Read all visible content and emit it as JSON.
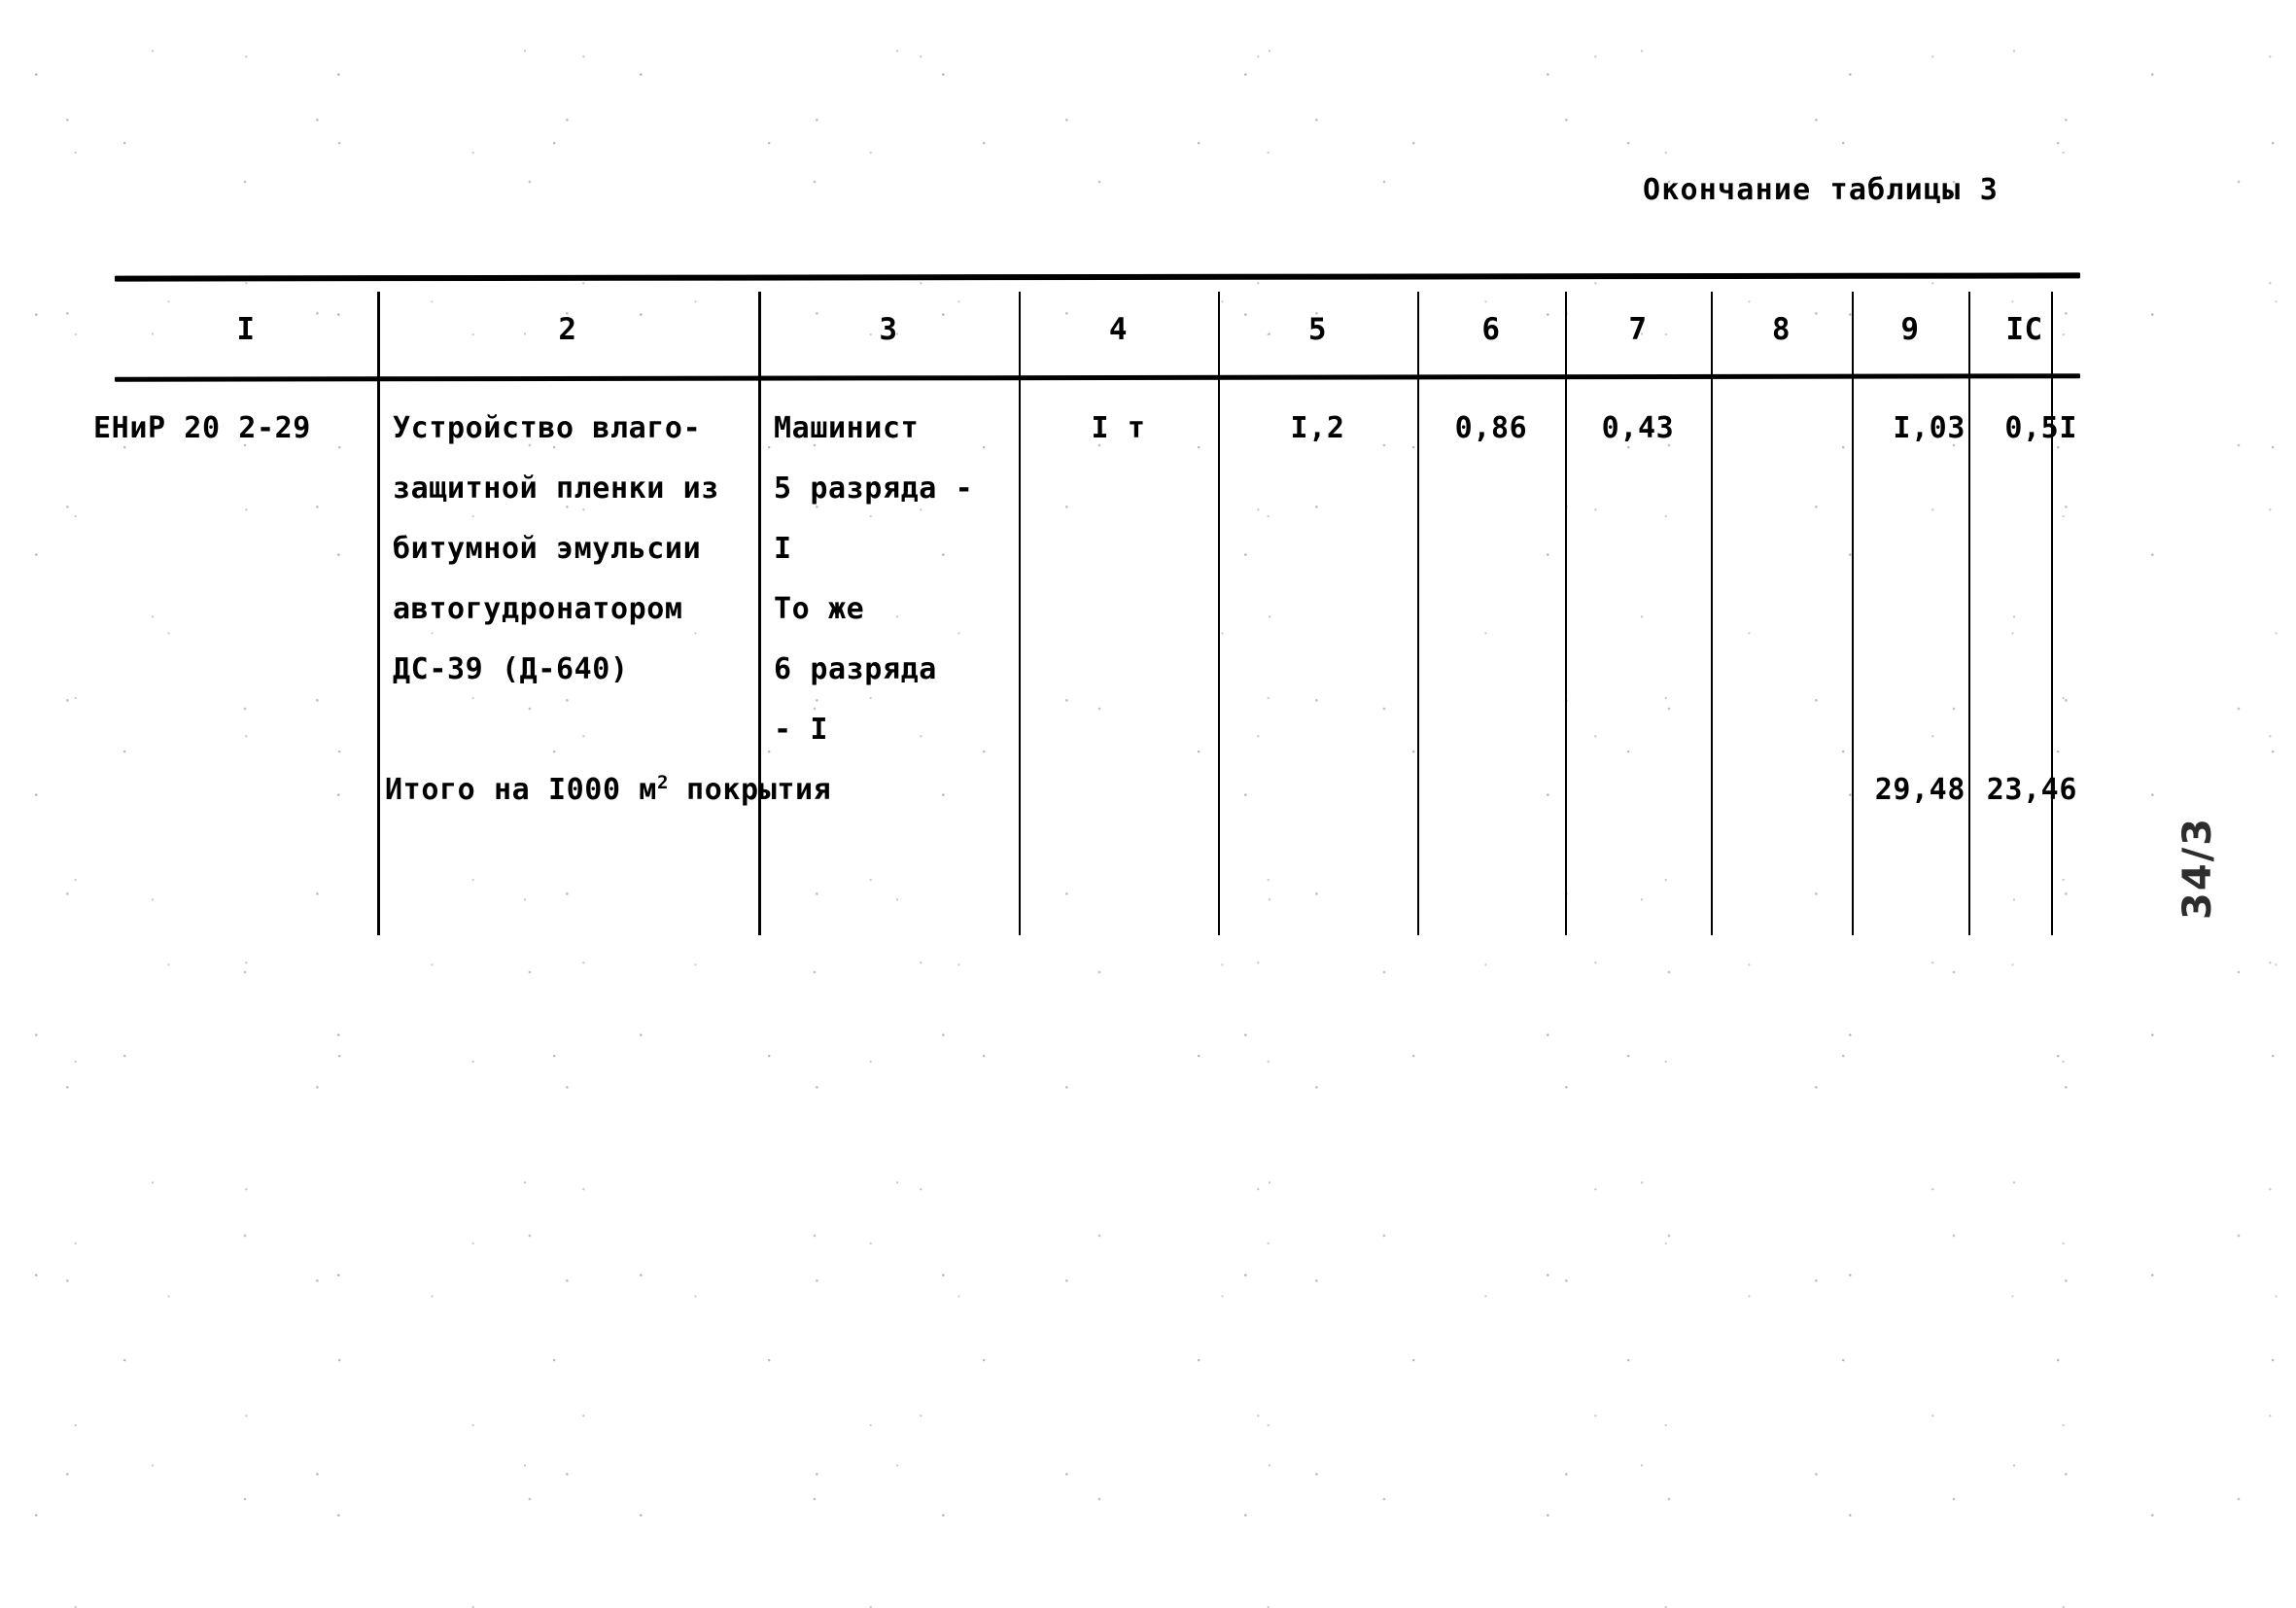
{
  "document": {
    "continuation_title": "Окончание таблицы 3",
    "archive_page_mark": "34/3",
    "language": "ru",
    "ink_color": "#000000",
    "paper_color": "#ffffff"
  },
  "table": {
    "column_headers": [
      "I",
      "2",
      "3",
      "4",
      "5",
      "6",
      "7",
      "8",
      "9",
      "IC"
    ],
    "rows": [
      {
        "name": "norm-row-enir-20-2-29",
        "col1": "ЕНиР 20 2-29",
        "col2_lines": [
          "Устройство влаго-",
          "защитной пленки из",
          "битумной эмульсии",
          "автогудронатором",
          "ДС-39 (Д-640)"
        ],
        "col3_lines": [
          "Машинист",
          "5 разряда -",
          "I",
          "То же",
          "6 разряда",
          "- I"
        ],
        "col4": "I т",
        "col5": "I,2",
        "col6": "0,86",
        "col7": "0,43",
        "col8": "",
        "col9": "I,03",
        "col10": "0,5I"
      },
      {
        "name": "norm-row-total",
        "total_label_prefix": "Итого на I000 м",
        "total_label_sup": "2",
        "total_label_suffix": " покрытия",
        "col9": "29,48",
        "col10": "23,46"
      }
    ]
  }
}
